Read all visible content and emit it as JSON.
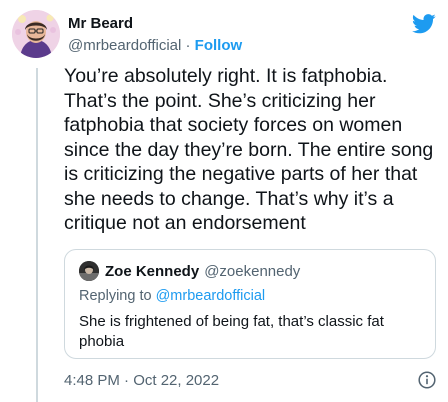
{
  "author": {
    "display_name": "Mr Beard",
    "handle": "@mrbeardofficial",
    "separator": "·",
    "follow_label": "Follow"
  },
  "tweet": {
    "text": "You’re absolutely right. It is fatphobia. That’s the point. She’s criticizing her fatphobia that society forces on women since the day they’re born. The entire song is criticizing the negative parts of her that she needs to change. That’s why it’s a critique not an endorsement",
    "timestamp": "4:48 PM · Oct 22, 2022"
  },
  "quoted_tweet": {
    "display_name": "Zoe Kennedy",
    "handle": "@zoekennedy",
    "replying_prefix": "Replying to",
    "replying_to": "@mrbeardofficial",
    "text": "She is frightened of being fat, that’s classic fat phobia"
  },
  "icons": {
    "brand": "twitter-bird-icon",
    "info": "info-icon"
  },
  "colors": {
    "accent": "#1d9bf0",
    "text": "#0f1419",
    "secondary": "#536471",
    "border": "#cfd9de"
  }
}
